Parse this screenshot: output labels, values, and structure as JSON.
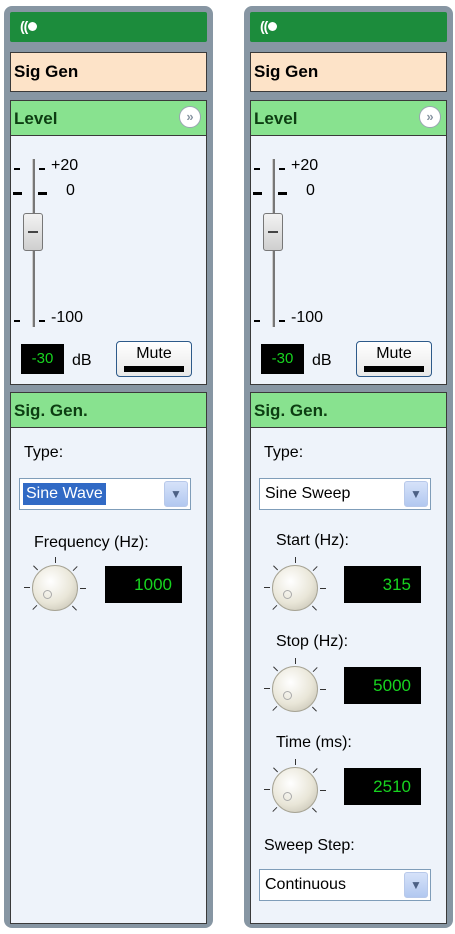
{
  "panels": [
    {
      "title": "Sig Gen",
      "level": {
        "header": "Level",
        "scale_top": "+20",
        "scale_mid": "0",
        "scale_bottom": "-100",
        "value": "-30",
        "unit": "dB",
        "mute_label": "Mute"
      },
      "siggen": {
        "header": "Sig. Gen.",
        "type_label": "Type:",
        "type_value": "Sine Wave",
        "frequency_label": "Frequency (Hz):",
        "frequency_value": "1000"
      }
    },
    {
      "title": "Sig Gen",
      "level": {
        "header": "Level",
        "scale_top": "+20",
        "scale_mid": "0",
        "scale_bottom": "-100",
        "value": "-30",
        "unit": "dB",
        "mute_label": "Mute"
      },
      "siggen": {
        "header": "Sig. Gen.",
        "type_label": "Type:",
        "type_value": "Sine Sweep",
        "start_label": "Start (Hz):",
        "start_value": "315",
        "stop_label": "Stop (Hz):",
        "stop_value": "5000",
        "time_label": "Time (ms):",
        "time_value": "2510",
        "sweep_step_label": "Sweep Step:",
        "sweep_step_value": "Continuous"
      }
    }
  ],
  "colors": {
    "frame": "#8796a3",
    "top_bar": "#1c8c3c",
    "name_bg": "#fde3c8",
    "section_header": "#88e28f",
    "section_bg": "#eef3fa",
    "readout_text": "#17d41f"
  },
  "icons": [
    "audio-block-icon",
    "collapse-chevron-icon",
    "dropdown-arrow-icon",
    "rotary-knob-icon"
  ]
}
